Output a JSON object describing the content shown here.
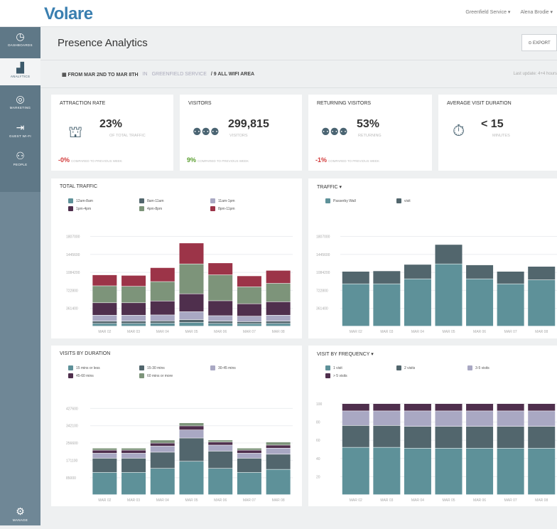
{
  "app": {
    "logo": "Volare",
    "user_menu": "Greenfield Service ▾",
    "account_menu": "Alena Brodie ▾"
  },
  "sidebar": {
    "items": [
      {
        "label": "DASHBOARDS",
        "icon": "dashboard-icon",
        "glyph": "◷"
      },
      {
        "label": "ANALYTICS",
        "icon": "analytics-icon",
        "glyph": "▟"
      },
      {
        "label": "MARKETING",
        "icon": "target-icon",
        "glyph": "◎"
      },
      {
        "label": "GUEST WI-FI",
        "icon": "login-icon",
        "glyph": "⇥"
      },
      {
        "label": "PEOPLE",
        "icon": "people-icon",
        "glyph": "⚇"
      }
    ],
    "bottom": {
      "label": "MANAGE",
      "glyph": "⚙"
    }
  },
  "header": {
    "title": "Presence Analytics",
    "export_label": "⊙ EXPORT"
  },
  "filters": {
    "date_range": "▦ FROM MAR 2ND TO MAR 8TH",
    "in_label": "IN",
    "location": "GREENFIELD SERVICE",
    "area": "/ 9 ALL WIFI AREA",
    "last_update": "Last update: 4+4 hours"
  },
  "kpis": [
    {
      "title": "ATTRACTION RATE",
      "value": "23%",
      "sub": "OF TOTAL TRAFFIC",
      "delta": "-0%",
      "delta_note": "COMPARED TO PREVIOUS WEEK",
      "delta_color": "#d33b3b",
      "icon": "store-traffic-icon",
      "glyph": "⛫"
    },
    {
      "title": "VISITORS",
      "value": "299,815",
      "sub": "VISITORS",
      "delta": "9%",
      "delta_note": "COMPARED TO PREVIOUS WEEK",
      "delta_color": "#5a9e2f",
      "icon": "visitors-icon",
      "glyph": "⚉⚉⚉"
    },
    {
      "title": "RETURNING VISITORS",
      "value": "53%",
      "sub": "RETURNING",
      "delta": "-1%",
      "delta_note": "COMPARED TO PREVIOUS WEEK",
      "delta_color": "#d33b3b",
      "icon": "returning-visitors-icon",
      "glyph": "⚉⚉⚉"
    },
    {
      "title": "AVERAGE VISIT DURATION",
      "value": "< 15",
      "sub": "MINUTES",
      "delta": "",
      "delta_note": "",
      "delta_color": "#333",
      "icon": "stopwatch-icon",
      "glyph": "⏱"
    }
  ],
  "colors": {
    "teal": "#5e9199",
    "slate": "#52666d",
    "lavender": "#a9a8c3",
    "plum": "#4f2f4d",
    "sage": "#7d947a",
    "crimson": "#9c3448"
  },
  "chart_data": [
    {
      "type": "bar",
      "title": "TOTAL TRAFFIC",
      "stacked": true,
      "categories": [
        "MAR 02",
        "MAR 03",
        "MAR 04",
        "MAR 05",
        "MAR 06",
        "MAR 07",
        "MAR 08"
      ],
      "ylim": [
        0,
        1800000
      ],
      "yticks": [
        "361400",
        "722800",
        "1084200",
        "1445600",
        "1807000"
      ],
      "series": [
        {
          "name": "12am-8am",
          "color": "#5e9199",
          "values": [
            55000,
            55000,
            60000,
            75000,
            55000,
            50000,
            55000
          ]
        },
        {
          "name": "8am-11am",
          "color": "#52666d",
          "values": [
            45000,
            45000,
            45000,
            55000,
            45000,
            40000,
            45000
          ]
        },
        {
          "name": "11am-1pm",
          "color": "#a9a8c3",
          "values": [
            120000,
            120000,
            120000,
            160000,
            110000,
            110000,
            120000
          ]
        },
        {
          "name": "1pm-4pm",
          "color": "#4f2f4d",
          "values": [
            250000,
            250000,
            280000,
            360000,
            300000,
            250000,
            270000
          ]
        },
        {
          "name": "4pm-8pm",
          "color": "#7d947a",
          "values": [
            340000,
            330000,
            390000,
            600000,
            520000,
            340000,
            370000
          ]
        },
        {
          "name": "8pm-11pm",
          "color": "#9c3448",
          "values": [
            220000,
            220000,
            280000,
            420000,
            240000,
            220000,
            260000
          ]
        }
      ]
    },
    {
      "type": "bar",
      "title": "TRAFFIC ▾",
      "stacked": true,
      "categories": [
        "MAR 02",
        "MAR 03",
        "MAR 04",
        "MAR 05",
        "MAR 06",
        "MAR 07",
        "MAR 08"
      ],
      "ylim": [
        0,
        1800000
      ],
      "yticks": [
        "361400",
        "722800",
        "1084200",
        "1445600",
        "1807000"
      ],
      "series": [
        {
          "name": "Passerby Wall",
          "color": "#5e9199",
          "values": [
            850000,
            850000,
            950000,
            1250000,
            950000,
            850000,
            930000
          ]
        },
        {
          "name": "visit",
          "color": "#52666d",
          "values": [
            250000,
            260000,
            290000,
            390000,
            280000,
            250000,
            270000
          ]
        }
      ]
    },
    {
      "type": "bar",
      "title": "VISITS BY DURATION",
      "stacked": true,
      "categories": [
        "MAR 02",
        "MAR 03",
        "MAR 04",
        "MAR 05",
        "MAR 06",
        "MAR 07",
        "MAR 08"
      ],
      "ylim": [
        0,
        450000
      ],
      "yticks": [
        "85000",
        "171100",
        "256600",
        "342100",
        "427600"
      ],
      "series": [
        {
          "name": "15 mins or less",
          "color": "#5e9199",
          "values": [
            110000,
            110000,
            130000,
            165000,
            130000,
            110000,
            125000
          ]
        },
        {
          "name": "15-30 mins",
          "color": "#52666d",
          "values": [
            70000,
            70000,
            80000,
            115000,
            85000,
            70000,
            75000
          ]
        },
        {
          "name": "30-45 mins",
          "color": "#a9a8c3",
          "values": [
            25000,
            25000,
            30000,
            40000,
            30000,
            25000,
            30000
          ]
        },
        {
          "name": "45-60 mins",
          "color": "#4f2f4d",
          "values": [
            15000,
            15000,
            15000,
            20000,
            15000,
            15000,
            15000
          ]
        },
        {
          "name": "60 mins or more",
          "color": "#7d947a",
          "values": [
            10000,
            10000,
            15000,
            15000,
            10000,
            10000,
            15000
          ]
        }
      ]
    },
    {
      "type": "bar",
      "title": "VISIT BY FREQUENCY ▾",
      "stacked": true,
      "categories": [
        "MAR 02",
        "MAR 03",
        "MAR 04",
        "MAR 05",
        "MAR 06",
        "MAR 07",
        "MAR 08"
      ],
      "ylim": [
        0,
        100
      ],
      "yticks": [
        "20",
        "40",
        "60",
        "80",
        "100"
      ],
      "series": [
        {
          "name": "1 visit",
          "color": "#5e9199",
          "values": [
            52,
            52,
            51,
            51,
            51,
            51,
            51
          ]
        },
        {
          "name": "2 visits",
          "color": "#52666d",
          "values": [
            24,
            24,
            24,
            24,
            24,
            24,
            24
          ]
        },
        {
          "name": "3-5 visits",
          "color": "#a9a8c3",
          "values": [
            16,
            16,
            17,
            17,
            17,
            17,
            17
          ]
        },
        {
          "name": "> 5 visits",
          "color": "#4f2f4d",
          "values": [
            8,
            8,
            8,
            8,
            8,
            8,
            8
          ]
        }
      ]
    }
  ]
}
